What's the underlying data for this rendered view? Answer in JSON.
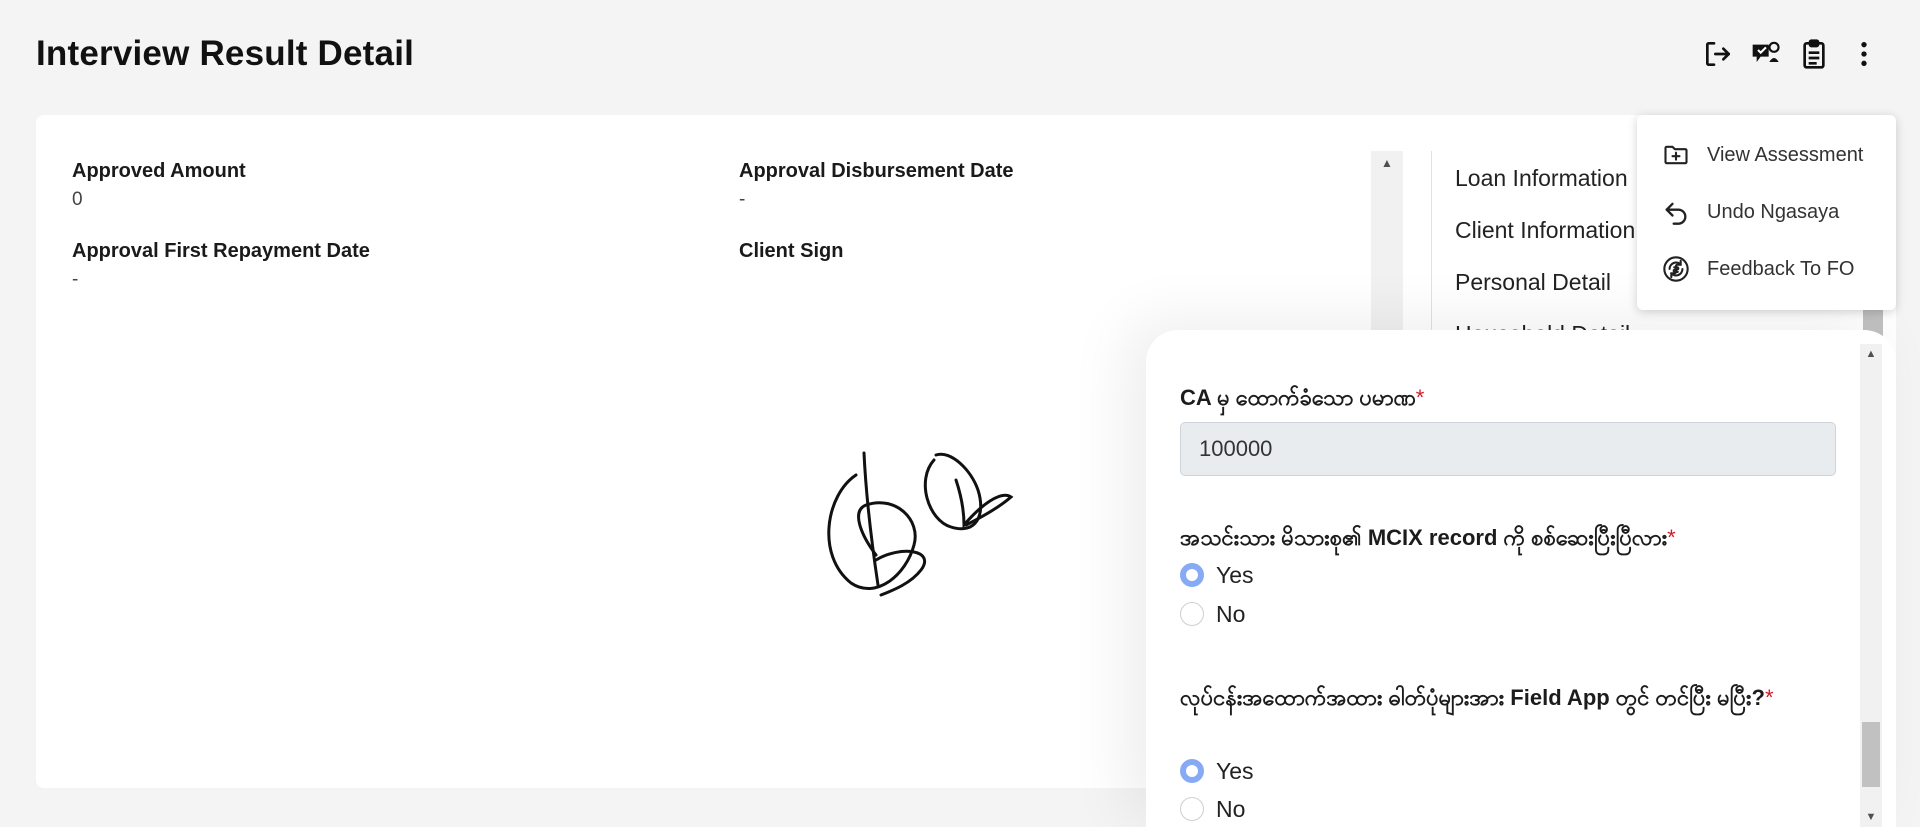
{
  "page": {
    "title": "Interview Result Detail"
  },
  "header": {
    "actions": [
      {
        "icon": "logout-icon"
      },
      {
        "icon": "feedback-icon"
      },
      {
        "icon": "clipboard-icon"
      },
      {
        "icon": "more-vertical-icon"
      }
    ]
  },
  "details": {
    "approved_amount": {
      "label": "Approved Amount",
      "value": "0"
    },
    "approval_disbursement_date": {
      "label": "Approval Disbursement Date",
      "value": "-"
    },
    "approval_first_repayment_date": {
      "label": "Approval First Repayment Date",
      "value": "-"
    },
    "client_sign": {
      "label": "Client Sign"
    }
  },
  "nav": {
    "items": [
      {
        "label": "Loan Information"
      },
      {
        "label": "Client Information"
      },
      {
        "label": "Personal Detail"
      },
      {
        "label": "Household Detail"
      }
    ]
  },
  "menu": {
    "items": [
      {
        "label": "View Assessment",
        "icon": "folder-plus-icon"
      },
      {
        "label": "Undo Ngasaya",
        "icon": "undo-icon"
      },
      {
        "label": "Feedback To FO",
        "icon": "refresh-dollar-icon"
      }
    ]
  },
  "form": {
    "q1": {
      "label": "CA မှ ထောက်ခံသော ပမာဏ",
      "required_mark": "*",
      "value": "100000"
    },
    "q2": {
      "label": "အသင်းသား မိသားစု၏ MCIX record ကို စစ်ဆေးပြီးပြီလား",
      "required_mark": "*",
      "options": [
        {
          "label": "Yes",
          "checked": true
        },
        {
          "label": "No",
          "checked": false
        }
      ]
    },
    "q3": {
      "label": "လုပ်ငန်းအထောက်အထား ဓါတ်ပုံများအား Field App တွင် တင်ပြီး မပြီး?",
      "required_mark": "*",
      "options": [
        {
          "label": "Yes",
          "checked": true
        },
        {
          "label": "No",
          "checked": false
        }
      ]
    }
  },
  "colors": {
    "background": "#f4f4f4",
    "card": "#ffffff",
    "required": "#d11a2a",
    "radio_checked": "#87aaf5",
    "input_bg": "#e9ecef"
  }
}
